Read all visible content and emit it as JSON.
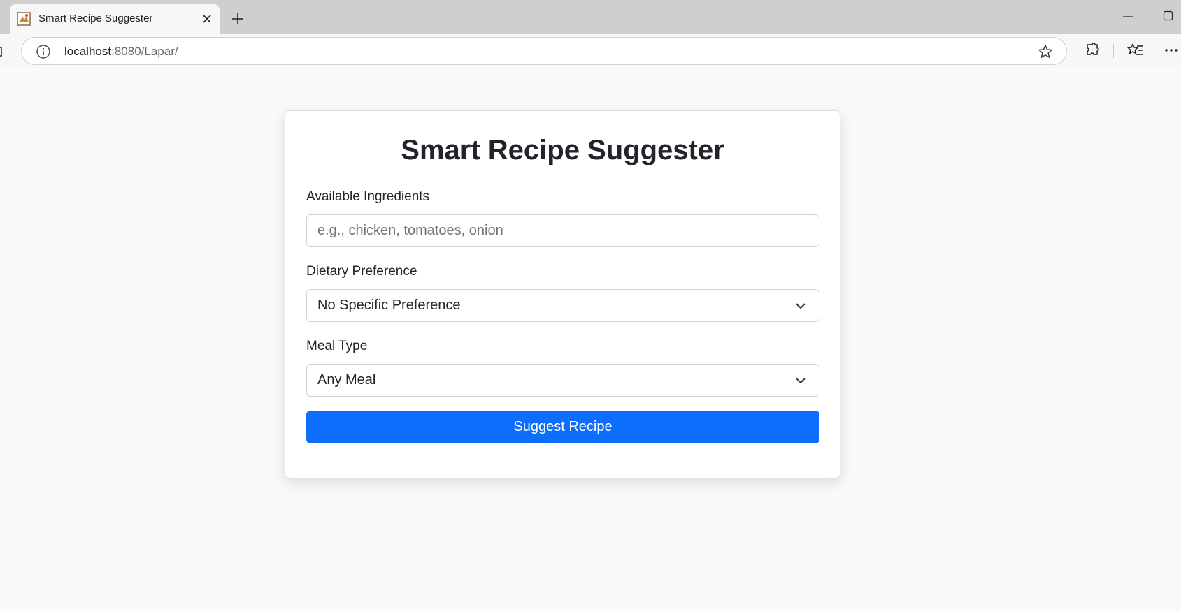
{
  "browser": {
    "tab_title": "Smart Recipe Suggester",
    "url_host": "localhost",
    "url_rest": ":8080/Lapar/"
  },
  "page": {
    "title": "Smart Recipe Suggester",
    "ingredients": {
      "label": "Available Ingredients",
      "placeholder": "e.g., chicken, tomatoes, onion",
      "value": ""
    },
    "dietary": {
      "label": "Dietary Preference",
      "selected": "No Specific Preference"
    },
    "meal_type": {
      "label": "Meal Type",
      "selected": "Any Meal"
    },
    "submit_label": "Suggest Recipe"
  },
  "colors": {
    "primary": "#0d6efd",
    "background": "#f8f9fa"
  }
}
